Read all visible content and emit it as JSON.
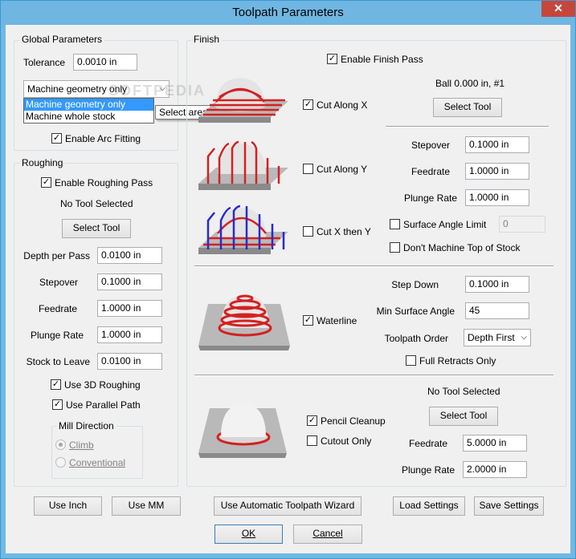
{
  "window": {
    "title": "Toolpath Parameters",
    "close_glyph": "✕"
  },
  "global": {
    "group_label": "Global Parameters",
    "tolerance_label": "Tolerance",
    "tolerance_value": "0.0010 in",
    "geometry_selected": "Machine geometry only",
    "geometry_options": [
      "Machine geometry only",
      "Machine whole stock"
    ],
    "tooltip": "Select area to machine",
    "arc_fitting": "Enable Arc Fitting",
    "arc_fitting_checked": true
  },
  "roughing": {
    "group_label": "Roughing",
    "enable": "Enable Roughing Pass",
    "tool_status": "No Tool Selected",
    "select_tool": "Select Tool",
    "fields": [
      {
        "label": "Depth per Pass",
        "value": "0.0100 in"
      },
      {
        "label": "Stepover",
        "value": "0.1000 in"
      },
      {
        "label": "Feedrate",
        "value": "1.0000 in"
      },
      {
        "label": "Plunge Rate",
        "value": "1.0000 in"
      },
      {
        "label": "Stock to Leave",
        "value": "0.0100 in"
      }
    ],
    "use_3d": "Use 3D Roughing",
    "use_parallel": "Use Parallel Path",
    "mill_direction": {
      "label": "Mill Direction",
      "climb": "Climb",
      "conventional": "Conventional",
      "selected": "Climb"
    }
  },
  "finish": {
    "group_label": "Finish",
    "enable": "Enable Finish Pass",
    "tool_info": "Ball 0.000 in, #1",
    "select_tool": "Select Tool",
    "cut_along_x": "Cut Along X",
    "cut_along_y": "Cut Along Y",
    "cut_x_then_y": "Cut X then Y",
    "stepover_label": "Stepover",
    "stepover_value": "0.1000 in",
    "feedrate_label": "Feedrate",
    "feedrate_value": "1.0000 in",
    "plunge_label": "Plunge Rate",
    "plunge_value": "1.0000 in",
    "surface_angle_limit": "Surface Angle Limit",
    "surface_angle_value": "0",
    "dont_machine_top": "Don't Machine Top of Stock",
    "waterline": "Waterline",
    "step_down_label": "Step Down",
    "step_down_value": "0.1000 in",
    "min_surface_angle_label": "Min Surface Angle",
    "min_surface_angle_value": "45",
    "toolpath_order_label": "Toolpath Order",
    "toolpath_order_value": "Depth First",
    "full_retracts": "Full Retracts Only",
    "pencil_tool_status": "No Tool Selected",
    "pencil_select_tool": "Select Tool",
    "pencil_cleanup": "Pencil Cleanup",
    "cutout_only": "Cutout Only",
    "pencil_feedrate_label": "Feedrate",
    "pencil_feedrate_value": "5.0000 in",
    "pencil_plunge_label": "Plunge Rate",
    "pencil_plunge_value": "2.0000 in"
  },
  "buttons": {
    "use_inch": "Use Inch",
    "use_mm": "Use MM",
    "wizard": "Use Automatic Toolpath Wizard",
    "load": "Load Settings",
    "save": "Save Settings",
    "ok": "OK",
    "cancel": "Cancel"
  },
  "colors": {
    "title_bar": "#6fb6e2",
    "close": "#c7463c",
    "highlight": "#3399ff",
    "path_red": "#d42020",
    "path_blue": "#2a2acc"
  }
}
